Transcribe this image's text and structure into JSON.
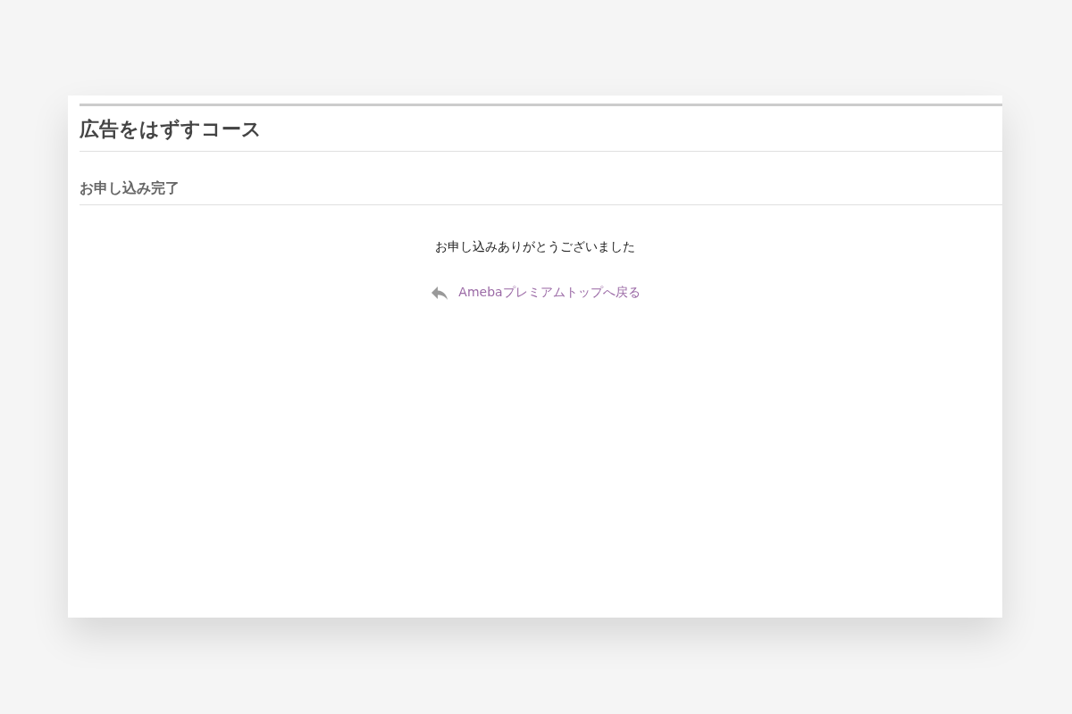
{
  "page": {
    "title": "広告をはずすコース",
    "section_title": "お申し込み完了",
    "message": "お申し込みありがとうございました",
    "back_link": "Amebaプレミアムトップへ戻る"
  }
}
